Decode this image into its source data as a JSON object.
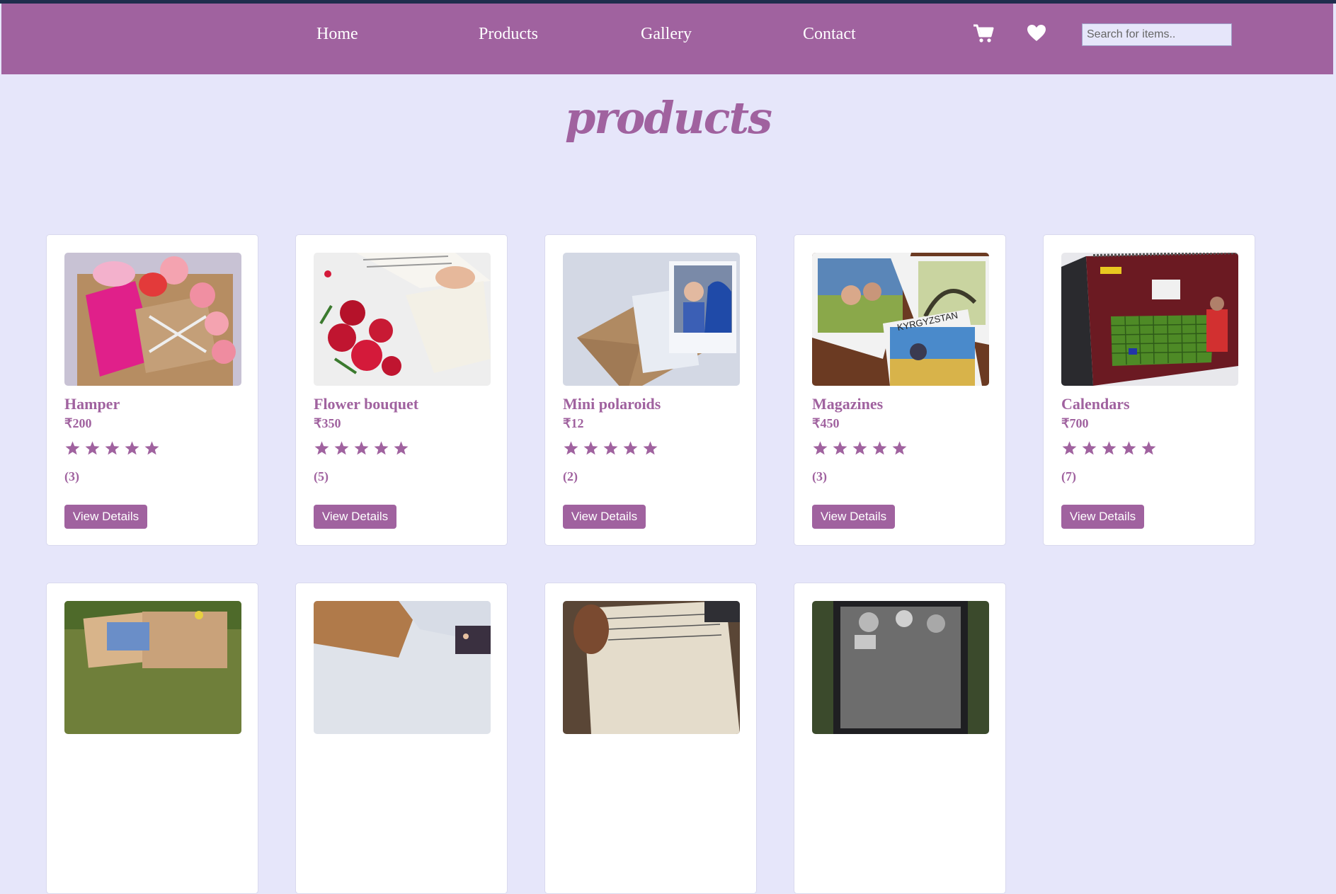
{
  "nav": {
    "links": [
      "Home",
      "Products",
      "Gallery",
      "Contact"
    ],
    "cart_icon": "cart-icon",
    "wishlist_icon": "heart-icon",
    "search_placeholder": "Search for items.."
  },
  "page_title": "products",
  "products": [
    {
      "name": "Hamper",
      "price": "₹200",
      "rating": 5,
      "reviews": "(3)",
      "button": "View Details"
    },
    {
      "name": "Flower bouquet",
      "price": "₹350",
      "rating": 5,
      "reviews": "(5)",
      "button": "View Details"
    },
    {
      "name": "Mini polaroids",
      "price": "₹12",
      "rating": 5,
      "reviews": "(2)",
      "button": "View Details"
    },
    {
      "name": "Magazines",
      "price": "₹450",
      "rating": 5,
      "reviews": "(3)",
      "button": "View Details"
    },
    {
      "name": "Calendars",
      "price": "₹700",
      "rating": 5,
      "reviews": "(7)",
      "button": "View Details"
    }
  ],
  "colors": {
    "accent": "#a0629f",
    "background": "#e6e6fa",
    "nav_top_strip": "#1f2d4d"
  }
}
